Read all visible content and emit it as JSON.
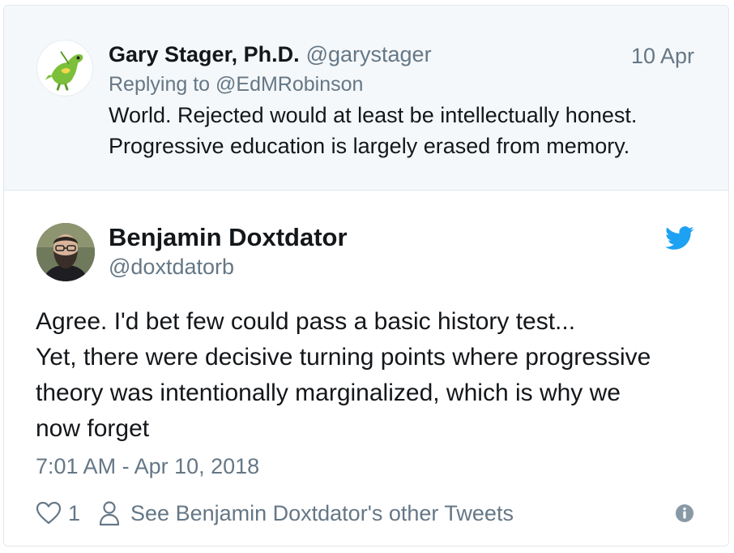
{
  "parent_tweet": {
    "avatar_icon": "dinosaur-cartoon-avatar",
    "author_name": "Gary Stager, Ph.D.",
    "author_handle": "@garystager",
    "date": "10 Apr",
    "replying_to": "Replying to @EdMRobinson",
    "text_lines": [
      "World. Rejected would at least be intellectually honest.",
      "Progressive education is largely erased from memory."
    ]
  },
  "tweet": {
    "author_name": "Benjamin Doxtdator",
    "author_handle": "@doxtdatorb",
    "brand_icon": "twitter-bird-icon",
    "text_lines": [
      "Agree. I'd bet few could pass a basic history test...",
      "Yet, there were decisive turning points where progressive",
      "theory was intentionally marginalized, which is why we",
      "now forget"
    ],
    "timestamp": "7:01 AM - Apr 10, 2018",
    "like_count": "1",
    "other_tweets_label": "See Benjamin Doxtdator's other Tweets"
  },
  "colors": {
    "twitter_blue": "#1da1f2",
    "secondary_text": "#657786",
    "primary_text": "#14171a",
    "parent_background": "#f5f8fa",
    "border": "#e1e8ed"
  }
}
